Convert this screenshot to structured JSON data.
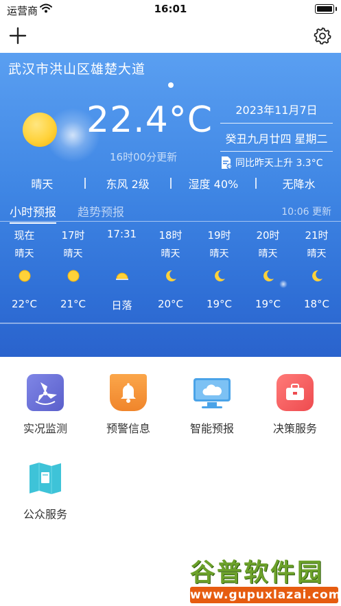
{
  "status_bar": {
    "carrier": "运营商",
    "time": "16:01"
  },
  "nav": {
    "add_icon": "plus-icon",
    "settings_icon": "gear-icon"
  },
  "weather": {
    "location": "武汉市洪山区雄楚大道",
    "temperature": "22.4°C",
    "updated": "16时00分更新",
    "date": "2023年11月7日",
    "lunar": "癸丑九月廿四 星期二",
    "compare": "同比昨天上升 3.3°C",
    "summary": {
      "condition": "晴天",
      "wind": "东风 2级",
      "humidity": "湿度 40%",
      "precip": "无降水"
    },
    "tabs": {
      "hourly": "小时预报",
      "trend": "趋势预报",
      "refresh": "10:06 更新"
    },
    "hourly": [
      {
        "time": "现在",
        "cond": "晴天",
        "icon": "sun-icon",
        "temp": "22°C"
      },
      {
        "time": "17时",
        "cond": "晴天",
        "icon": "sun-icon",
        "temp": "21°C"
      },
      {
        "time": "17:31",
        "cond": "",
        "icon": "sunset-icon",
        "temp": "日落"
      },
      {
        "time": "18时",
        "cond": "晴天",
        "icon": "moon-icon",
        "temp": "20°C"
      },
      {
        "time": "19时",
        "cond": "晴天",
        "icon": "moon-icon",
        "temp": "19°C"
      },
      {
        "time": "20时",
        "cond": "晴天",
        "icon": "moon-icon",
        "temp": "19°C"
      },
      {
        "time": "21时",
        "cond": "晴天",
        "icon": "moon-icon",
        "temp": "18°C"
      }
    ]
  },
  "services": [
    {
      "label": "实况监测",
      "icon": "windmill-icon",
      "color": "#6e6fd4"
    },
    {
      "label": "预警信息",
      "icon": "bell-icon",
      "color": "#f59a3a"
    },
    {
      "label": "智能预报",
      "icon": "monitor-cloud-icon",
      "color": "#4aa3e8"
    },
    {
      "label": "决策服务",
      "icon": "briefcase-icon",
      "color": "#f0585a"
    },
    {
      "label": "公众服务",
      "icon": "book-icon",
      "color": "#3ec3d8"
    }
  ],
  "watermark": {
    "title": "谷普软件园",
    "url": "www.gupuxlazai.com"
  }
}
